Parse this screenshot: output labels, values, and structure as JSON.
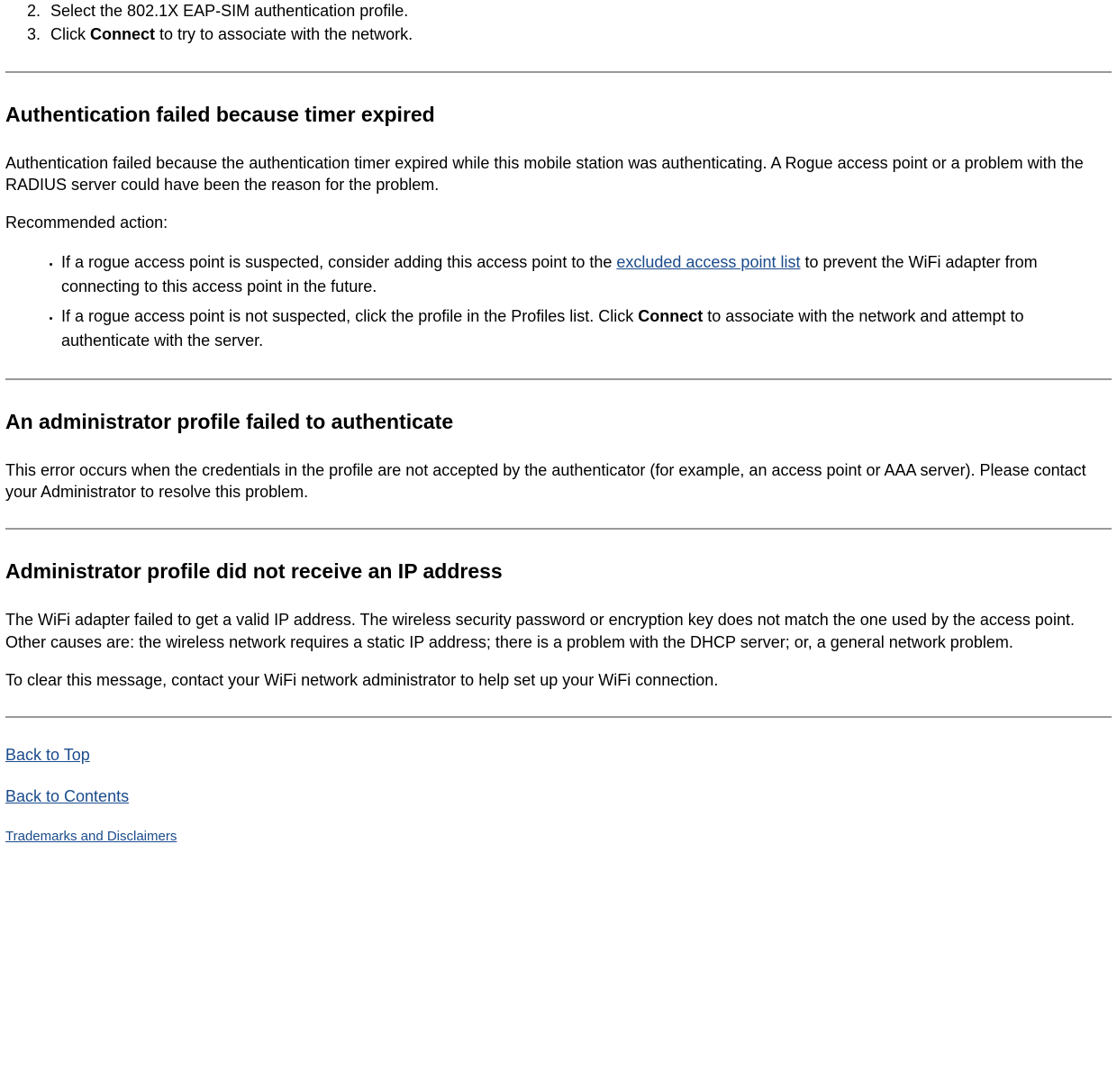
{
  "topList": {
    "item2": "Select the 802.1X EAP-SIM authentication profile.",
    "item3_pre": "Click ",
    "item3_bold": "Connect",
    "item3_post": " to try to associate with the network."
  },
  "section1": {
    "heading": "Authentication failed because timer expired",
    "para1": "Authentication failed because the authentication timer expired while this mobile station was authenticating. A Rogue access point or a problem with the RADIUS server could have been the reason for the problem.",
    "para2": "Recommended action:",
    "bullet1_pre": "If a rogue access point is suspected, consider adding this access point to the ",
    "bullet1_link": "excluded access point list",
    "bullet1_post": " to prevent the WiFi adapter from connecting to this access point in the future.",
    "bullet2_pre": "If a rogue access point is not suspected, click the profile in the Profiles list. Click ",
    "bullet2_bold": "Connect",
    "bullet2_post": " to associate with the network and attempt to authenticate with the server."
  },
  "section2": {
    "heading": "An administrator profile failed to authenticate",
    "para1": "This error occurs when the credentials in the profile are not accepted by the authenticator (for example, an access point or AAA server). Please contact your Administrator to resolve this problem."
  },
  "section3": {
    "heading": "Administrator profile did not receive an IP address",
    "para1": "The WiFi adapter failed to get a valid IP address. The wireless security password or encryption key does not match the one used by the access point. Other causes are: the wireless network requires a static IP address; there is a problem with the DHCP server; or, a general network problem.",
    "para2": "To clear this message, contact your WiFi network administrator to help set up your WiFi connection."
  },
  "nav": {
    "backToTop": "Back to Top",
    "backToContents": "Back to Contents",
    "trademarks": "Trademarks and Disclaimers"
  }
}
